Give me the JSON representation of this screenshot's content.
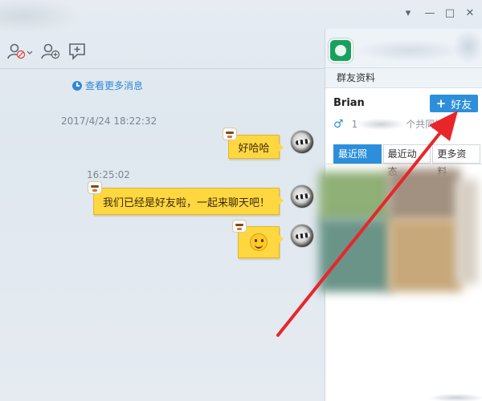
{
  "window": {
    "controls": {
      "dropdown": "▾",
      "minimize": "—",
      "maximize": "□",
      "close": "✕"
    }
  },
  "toolbar": {
    "icons": [
      "block-user-icon",
      "add-contact-icon",
      "add-comment-icon"
    ]
  },
  "chat": {
    "more_messages": "查看更多消息",
    "messages": [
      {
        "time": "2017/4/24 18:22:32",
        "text": "好哈哈"
      },
      {
        "time": "16:25:02",
        "text": "我们已经是好友啦，一起来聊天吧！"
      },
      {
        "time": "",
        "text": "",
        "emoji": "smiley"
      }
    ]
  },
  "panel": {
    "group_tab": "群友资料",
    "name": "Brian",
    "add_friend_label": "好友",
    "info_prefix": "1",
    "info_suffix": "个共同好友",
    "tabs": [
      "最近照片",
      "最近动态",
      "更多资料"
    ],
    "active_tab": 0
  },
  "annotation": {
    "arrow_color": "#e8262a"
  },
  "colors": {
    "accent": "#2d8fdb",
    "bubble": "#ffd740",
    "link": "#2f88d6"
  }
}
